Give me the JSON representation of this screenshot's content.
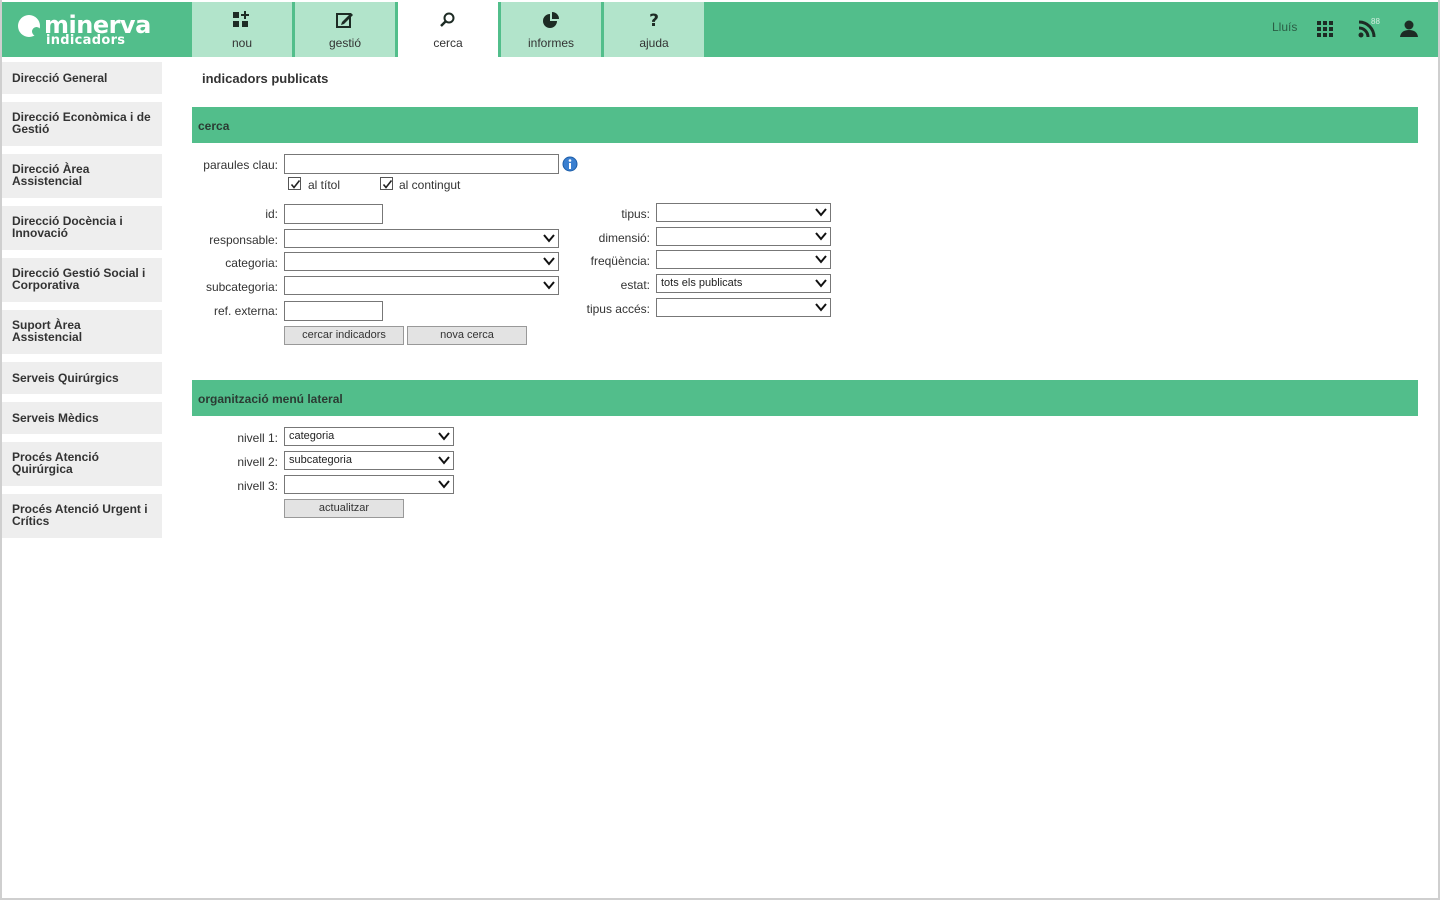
{
  "app": {
    "logo_name": "minerva",
    "logo_sub": "indicadors"
  },
  "nav": {
    "tabs": [
      {
        "label": "nou",
        "icon": "new-icon"
      },
      {
        "label": "gestió",
        "icon": "edit-icon"
      },
      {
        "label": "cerca",
        "icon": "search-icon",
        "active": true
      },
      {
        "label": "informes",
        "icon": "pie-chart-icon"
      },
      {
        "label": "ajuda",
        "icon": "help-icon"
      }
    ],
    "user": "Lluís",
    "rss_count": "88"
  },
  "sidebar": {
    "items": [
      {
        "label": "Direcció General"
      },
      {
        "label": "Direcció Econòmica i de Gestió"
      },
      {
        "label": "Direcció Àrea Assistencial"
      },
      {
        "label": "Direcció Docència i Innovació"
      },
      {
        "label": "Direcció Gestió Social i Corporativa"
      },
      {
        "label": "Suport Àrea Assistencial"
      },
      {
        "label": "Serveis Quirúrgics"
      },
      {
        "label": "Serveis Mèdics"
      },
      {
        "label": "Procés Atenció Quirúrgica"
      },
      {
        "label": "Procés Atenció Urgent i Crítics"
      }
    ]
  },
  "main": {
    "title": "indicadors publicats",
    "search": {
      "header": "cerca",
      "keywords_label": "paraules clau:",
      "keywords_value": "",
      "in_title_label": "al títol",
      "in_title_checked": true,
      "in_content_label": "al contingut",
      "in_content_checked": true,
      "id_label": "id:",
      "id_value": "",
      "responsable_label": "responsable:",
      "responsable_value": "",
      "categoria_label": "categoria:",
      "categoria_value": "",
      "subcategoria_label": "subcategoria:",
      "subcategoria_value": "",
      "ref_label": "ref. externa:",
      "ref_value": "",
      "tipus_label": "tipus:",
      "tipus_value": "",
      "dimensio_label": "dimensió:",
      "dimensio_value": "",
      "frequencia_label": "freqüència:",
      "frequencia_value": "",
      "estat_label": "estat:",
      "estat_value": "tots els publicats",
      "tipus_acces_label": "tipus accés:",
      "tipus_acces_value": "",
      "search_button": "cercar indicadors",
      "new_search_button": "nova cerca"
    },
    "menu": {
      "header": "organització menú lateral",
      "level1_label": "nivell 1:",
      "level1_value": "categoria",
      "level2_label": "nivell 2:",
      "level2_value": "subcategoria",
      "level3_label": "nivell 3:",
      "level3_value": "",
      "update_button": "actualitzar"
    }
  }
}
